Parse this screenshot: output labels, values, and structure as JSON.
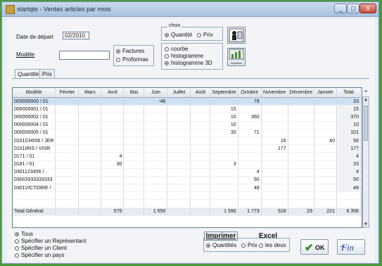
{
  "window": {
    "title": "startqte - Ventes articles par mois",
    "controls": [
      "_",
      "□",
      "X"
    ]
  },
  "header": {
    "date_label": "Date de départ",
    "date_value": "02/2010",
    "modele_label": "Modèle",
    "modele_value": "",
    "doc_type": {
      "factures": "Factures",
      "proformas": "Proformas",
      "selected": "factures"
    },
    "choix": {
      "caption": "choix",
      "quantite": "Quantité",
      "prix": "Prix",
      "selected": "quantite",
      "graph_types": [
        "courbe",
        "histogramme",
        "histogramme 3D"
      ],
      "graph_selected": 2
    },
    "print_icon_label": "Imprimer"
  },
  "tabs": [
    "Quantité",
    "Prix"
  ],
  "table": {
    "columns": [
      "Modèle",
      "Février",
      "Mars",
      "Avril",
      "Mai",
      "Juin",
      "Juillet",
      "Août",
      "Septembre",
      "Octobre",
      "Novembre",
      "Décembre",
      "Janvier",
      "Total"
    ],
    "rows": [
      [
        "000000000 / 01",
        "",
        "",
        "",
        "",
        "-46",
        "",
        "",
        "",
        "79",
        "",
        "",
        "",
        "33"
      ],
      [
        "000000001 / 01",
        "",
        "",
        "",
        "",
        "",
        "",
        "",
        "15",
        "",
        "",
        "",
        "",
        "15"
      ],
      [
        "000000002 / 01",
        "",
        "",
        "",
        "",
        "",
        "",
        "",
        "10",
        "360",
        "",
        "",
        "",
        "370"
      ],
      [
        "000000004 / 01",
        "",
        "",
        "",
        "",
        "",
        "",
        "",
        "10",
        "",
        "",
        "",
        "",
        "10"
      ],
      [
        "000000005 / 01",
        "",
        "",
        "",
        "",
        "",
        "",
        "",
        "30",
        "71",
        "",
        "",
        "",
        "101"
      ],
      [
        "0101CH006 / JER",
        "",
        "",
        "",
        "",
        "",
        "",
        "",
        "",
        "",
        "16",
        "",
        "40",
        "56"
      ],
      [
        "0101IRIS / VISR",
        "",
        "",
        "",
        "",
        "",
        "",
        "",
        "",
        "",
        "177",
        "",
        "",
        "177"
      ],
      [
        "0171 / 01",
        "",
        "",
        "4",
        "",
        "",
        "",
        "",
        "",
        "",
        "",
        "",
        "",
        "4"
      ],
      [
        "0181 / 01",
        "",
        "",
        "30",
        "",
        "",
        "",
        "",
        "3",
        "",
        "",
        "",
        "",
        "33"
      ],
      [
        "0301123456 / .",
        "",
        "",
        "",
        "",
        "",
        "",
        "",
        "",
        "4",
        "",
        "",
        "",
        "4"
      ],
      [
        "03003333333333",
        "",
        "",
        "",
        "",
        "",
        "",
        "",
        "",
        "50",
        "",
        "",
        "",
        "50"
      ],
      [
        "0301VICTOIRE / .",
        "",
        "",
        "",
        "",
        "",
        "",
        "",
        "",
        "48",
        "",
        "",
        "",
        "48"
      ]
    ],
    "total": [
      "Total Général",
      "",
      "",
      "575",
      "",
      "1 650",
      "",
      "",
      "1 590",
      "1 773",
      "518",
      "29",
      "221",
      "6 356"
    ]
  },
  "footer": {
    "scope_options": [
      "Tous",
      "Spécifier un Représentant",
      "Spécifier un Client",
      "Spécifier un pays"
    ],
    "scope_selected": 0,
    "imprimer": "Imprimer",
    "excel": "Excel",
    "export_options": [
      "Quantités",
      "Prix",
      "les deux"
    ],
    "export_selected": 0,
    "ok": "OK",
    "fin": "Fin"
  }
}
